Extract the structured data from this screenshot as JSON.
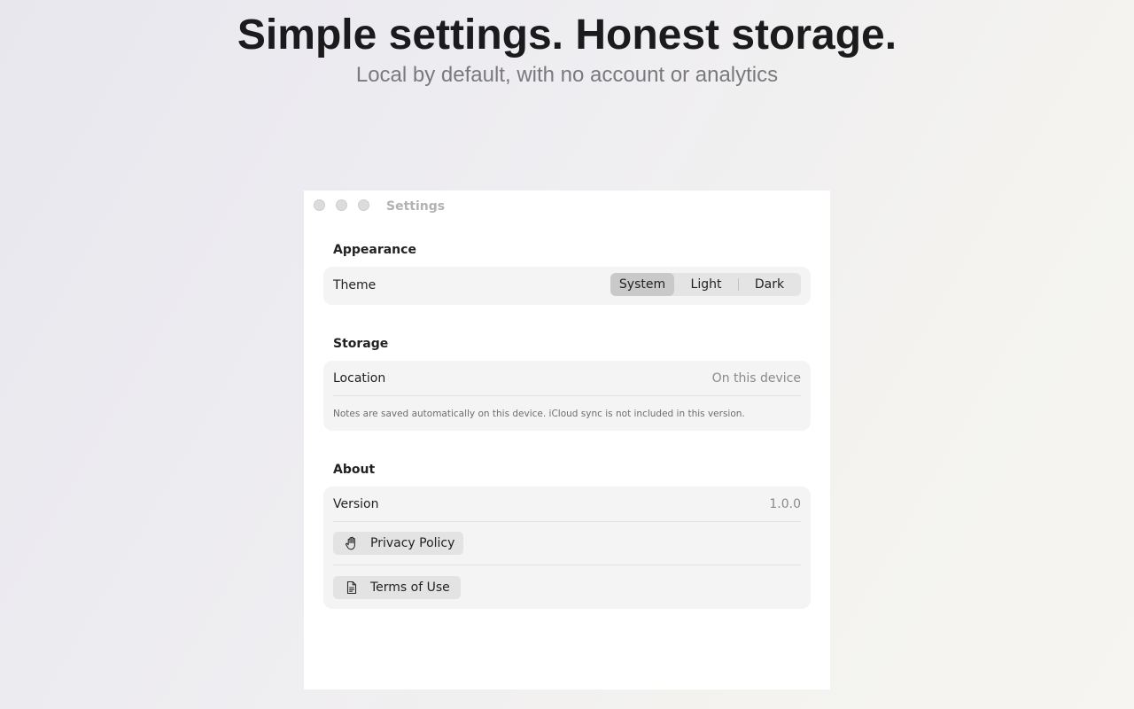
{
  "hero": {
    "title": "Simple settings. Honest storage.",
    "subtitle": "Local by default, with no account or analytics"
  },
  "window": {
    "title": "Settings",
    "traffic_lights": [
      "close",
      "minimize",
      "zoom"
    ]
  },
  "appearance": {
    "header": "Appearance",
    "theme_label": "Theme",
    "theme_options": [
      "System",
      "Light",
      "Dark"
    ],
    "theme_selected": "System"
  },
  "storage": {
    "header": "Storage",
    "location_label": "Location",
    "location_value": "On this device",
    "note": "Notes are saved automatically on this device. iCloud sync is not included in this version."
  },
  "about": {
    "header": "About",
    "version_label": "Version",
    "version_value": "1.0.0",
    "privacy_label": "Privacy Policy",
    "privacy_icon": "hand-raised-icon",
    "terms_label": "Terms of Use",
    "terms_icon": "document-icon"
  },
  "colors": {
    "selected_segment": "#c9c9c9",
    "group_background": "#f4f4f4",
    "button_background": "#e3e3e3"
  }
}
